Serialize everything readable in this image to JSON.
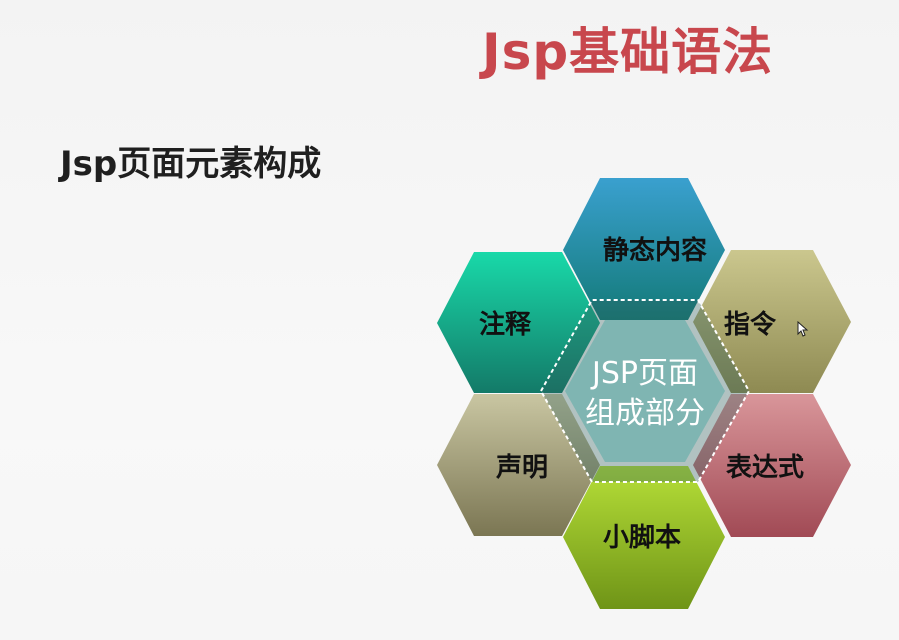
{
  "slide": {
    "title": "Jsp基础语法",
    "subheading": "Jsp页面元素构成"
  },
  "diagram": {
    "center": {
      "line1": "JSP页面",
      "line2": "组成部分",
      "color": "#7fb5b2"
    },
    "hexes": [
      {
        "id": "static-content",
        "label": "静态内容",
        "color_light": "#3aa0cf",
        "color_dark": "#137a78"
      },
      {
        "id": "comment",
        "label": "注释",
        "color_light": "#19d9a9",
        "color_dark": "#137a68"
      },
      {
        "id": "directive",
        "label": "指令",
        "color_light": "#cbc78e",
        "color_dark": "#8e8a52"
      },
      {
        "id": "declaration",
        "label": "声明",
        "color_light": "#c9c6a2",
        "color_dark": "#7b7653"
      },
      {
        "id": "expression",
        "label": "表达式",
        "color_light": "#d9969a",
        "color_dark": "#a14a55"
      },
      {
        "id": "scriptlet",
        "label": "小脚本",
        "color_light": "#b6df38",
        "color_dark": "#6f9417"
      }
    ]
  }
}
